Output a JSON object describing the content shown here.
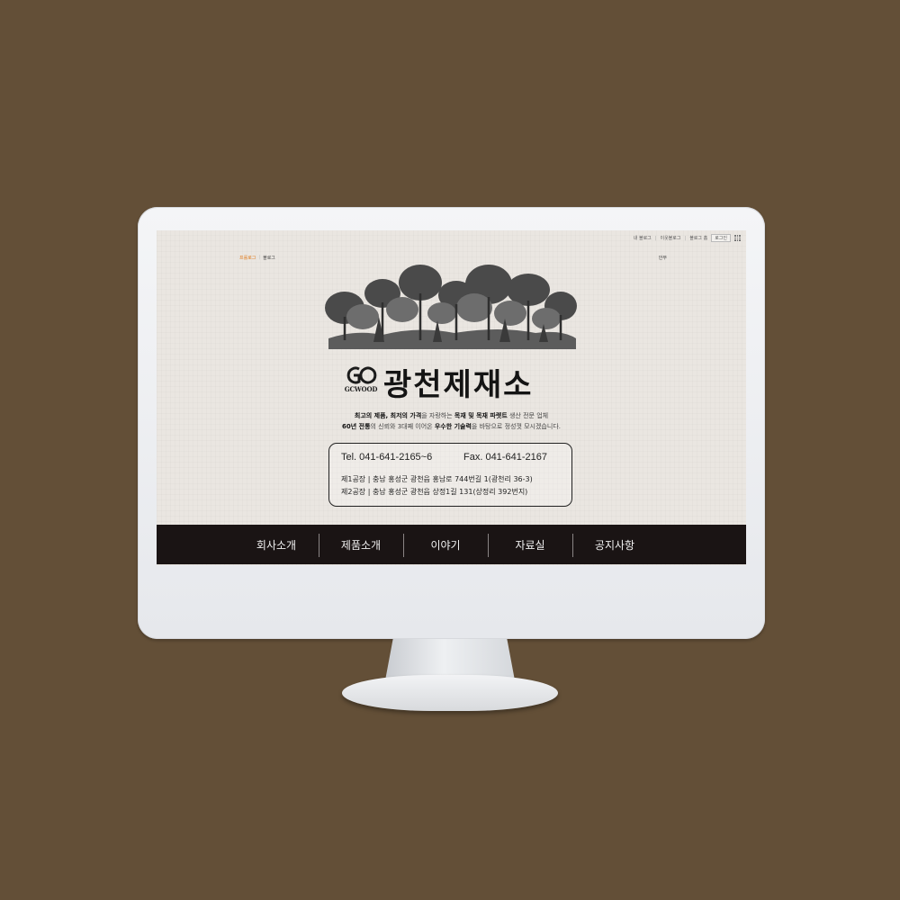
{
  "top_bar": {
    "links": [
      "내 블로그",
      "이웃블로그",
      "블로그 홈"
    ],
    "login_label": "로그인"
  },
  "blog_tabs": {
    "active": "프롤로그",
    "other": "블로그"
  },
  "language_label": "안부",
  "logo": {
    "brand": "GCWOOD"
  },
  "company_name": "광천제재소",
  "tagline": {
    "line1_a": "최고의 제품, 최저의 가격",
    "line1_b": "을 자랑하는 ",
    "line1_c": "목재 및 목재 파렛트",
    "line1_d": " 생산 전문 업체",
    "line2_a": "60년 전통",
    "line2_b": "의 신뢰와 3대째 이어온 ",
    "line2_c": "우수한 기술력",
    "line2_d": "을 바탕으로 정성껏 모시겠습니다."
  },
  "contact": {
    "tel": "Tel. 041-641-2165~6",
    "fax": "Fax. 041-641-2167",
    "address1": "제1공장 | 충남 홍성군 광천읍 홍남로 744번길 1(광천리 36-3)",
    "address2": "제2공장 | 충남 홍성군 광천읍 상정1길 131(상정리 392번지)"
  },
  "nav": [
    "회사소개",
    "제품소개",
    "이야기",
    "자료실",
    "공지사항"
  ],
  "colors": {
    "background": "#634f37",
    "nav_bg": "#1a1414",
    "accent": "#e07a1a"
  }
}
